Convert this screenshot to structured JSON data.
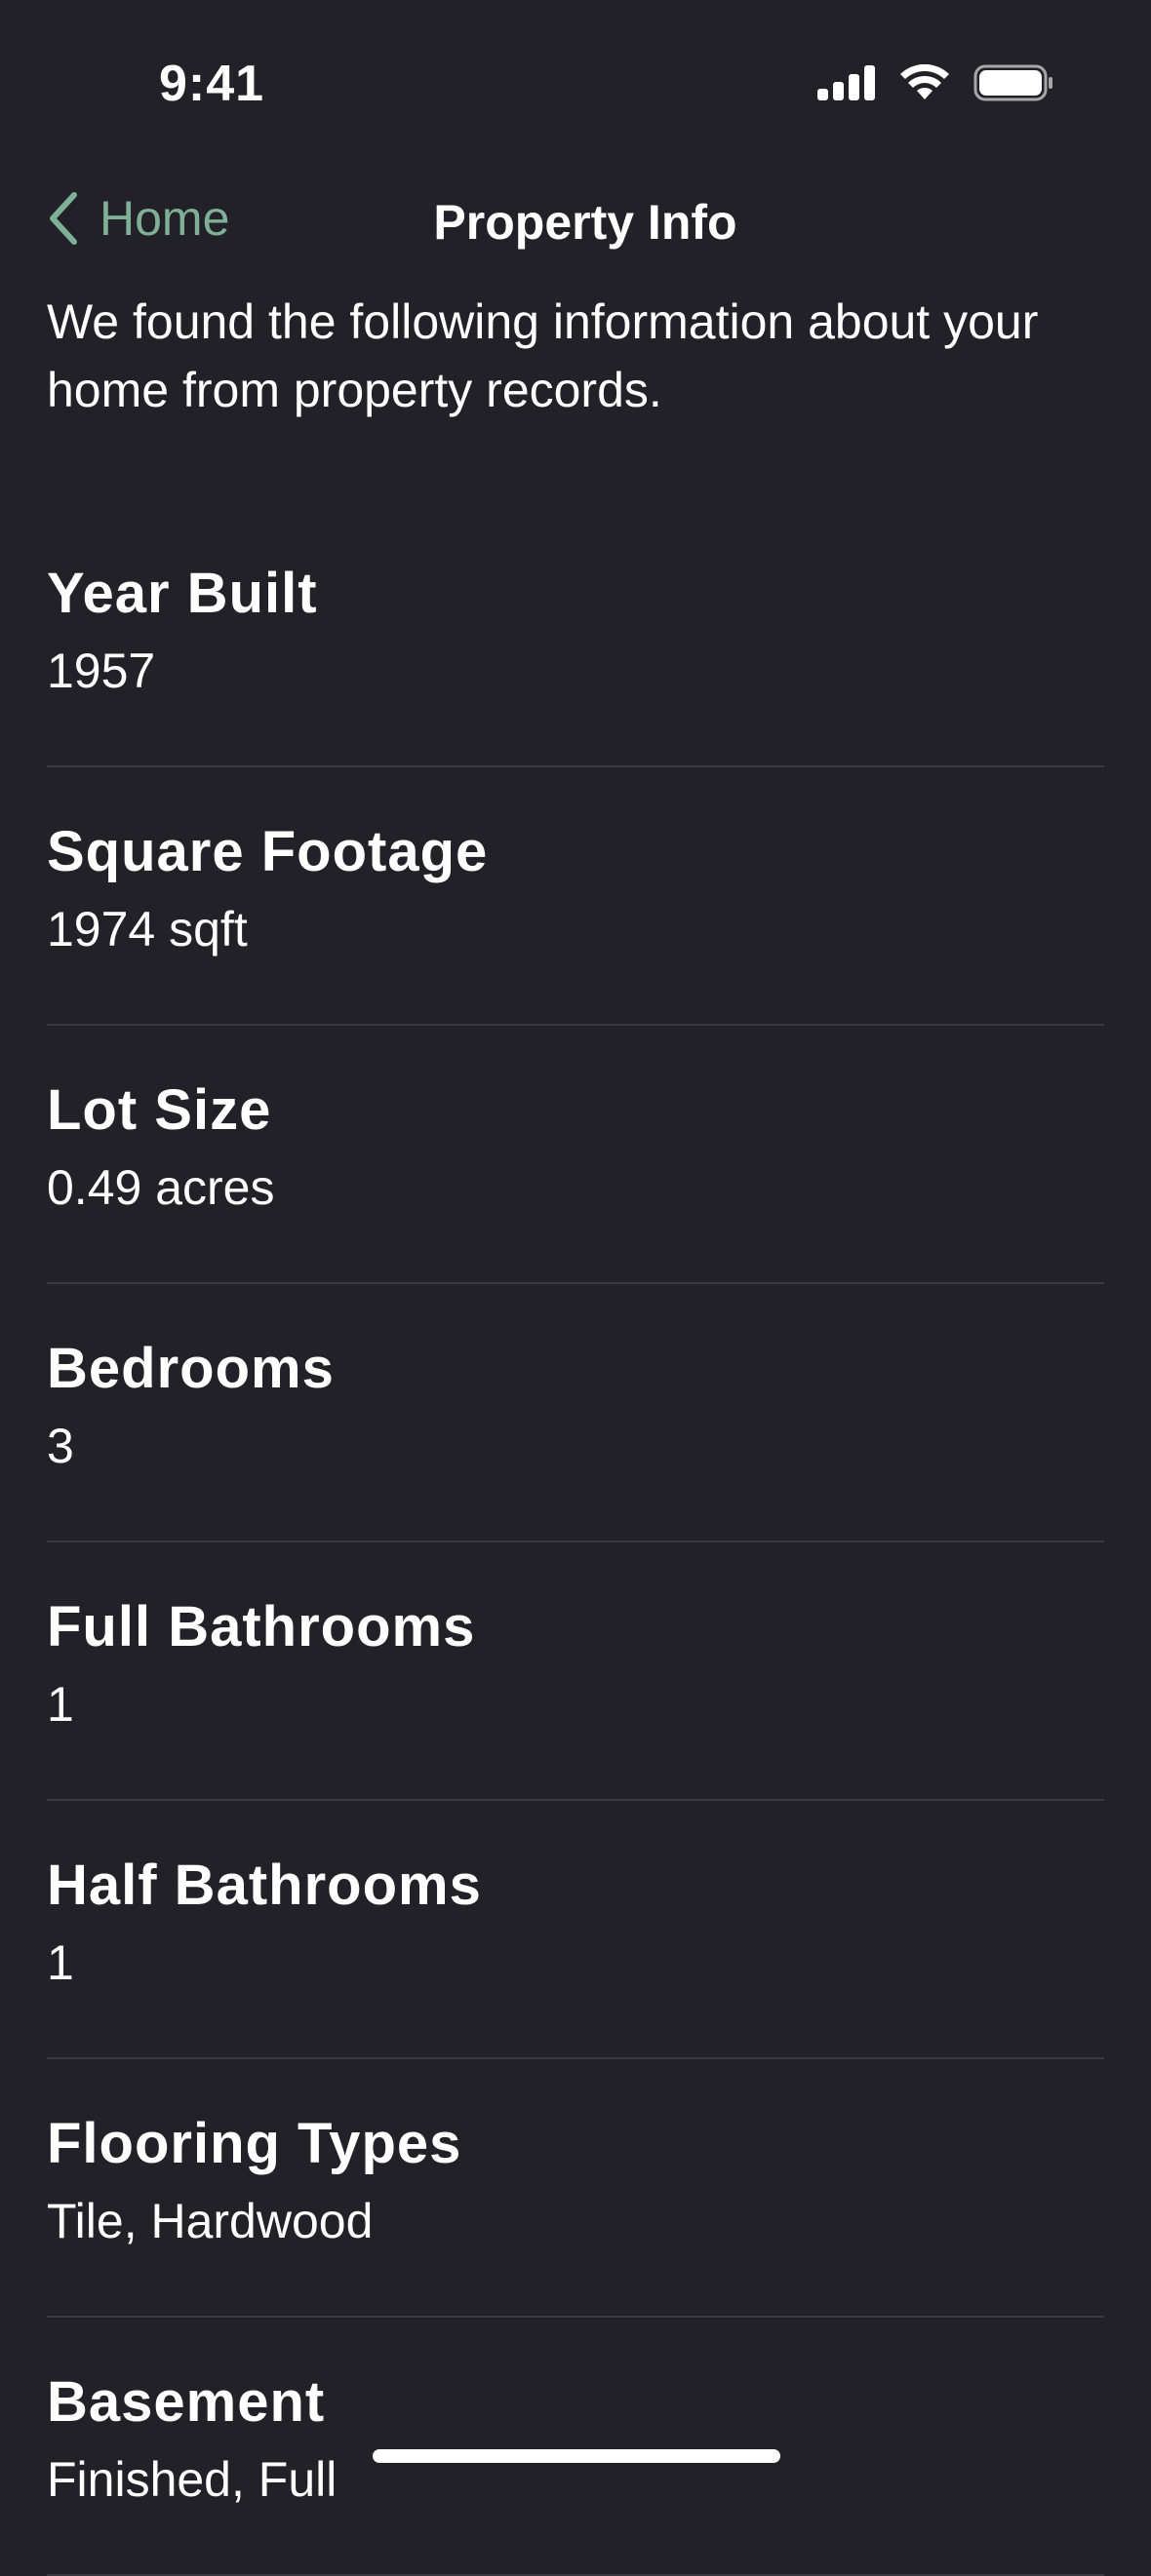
{
  "status_bar": {
    "time": "9:41"
  },
  "nav": {
    "back_label": "Home",
    "title": "Property Info"
  },
  "intro": "We found the following information about your home from property records.",
  "items": [
    {
      "label": "Year Built",
      "value": "1957"
    },
    {
      "label": "Square Footage",
      "value": "1974 sqft"
    },
    {
      "label": "Lot Size",
      "value": "0.49 acres"
    },
    {
      "label": "Bedrooms",
      "value": "3"
    },
    {
      "label": "Full Bathrooms",
      "value": "1"
    },
    {
      "label": "Half Bathrooms",
      "value": "1"
    },
    {
      "label": "Flooring Types",
      "value": "Tile, Hardwood"
    },
    {
      "label": "Basement",
      "value": "Finished, Full"
    }
  ],
  "colors": {
    "background": "#232128",
    "accent": "#7faf97",
    "divider": "#3a3840"
  }
}
